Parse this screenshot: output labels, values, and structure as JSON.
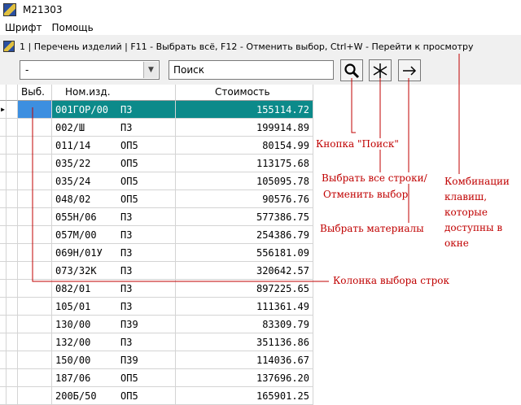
{
  "titlebar": {
    "title": "M21303",
    "icon": "app-icon"
  },
  "menu": {
    "items": [
      "Шрифт",
      "Помощь"
    ]
  },
  "window": {
    "title": "1 | Перечень изделий | F11 - Выбрать всё, F12 - Отменить выбор, Ctrl+W - Перейти к просмотру"
  },
  "toolbar": {
    "combo_value": "-",
    "search_value": "Поиск",
    "buttons": [
      "search-icon",
      "asterisk-icon",
      "arrow-right-icon"
    ]
  },
  "table": {
    "columns": [
      "Выб.",
      "Ном.изд.",
      "Стоимость"
    ],
    "rows": [
      {
        "num": "001ГОР/00",
        "type": "ПЗ",
        "cost": "155114.72"
      },
      {
        "num": "002/Ш",
        "type": "ПЗ",
        "cost": "199914.89"
      },
      {
        "num": "011/14",
        "type": "ОП5",
        "cost": "80154.99"
      },
      {
        "num": "035/22",
        "type": "ОП5",
        "cost": "113175.68"
      },
      {
        "num": "035/24",
        "type": "ОП5",
        "cost": "105095.78"
      },
      {
        "num": "048/02",
        "type": "ОП5",
        "cost": "90576.76"
      },
      {
        "num": "055Н/06",
        "type": "ПЗ",
        "cost": "577386.75"
      },
      {
        "num": "057М/00",
        "type": "ПЗ",
        "cost": "254386.79"
      },
      {
        "num": "069Н/01У",
        "type": "ПЗ",
        "cost": "556181.09"
      },
      {
        "num": "073/32К",
        "type": "ПЗ",
        "cost": "320642.57"
      },
      {
        "num": "082/01",
        "type": "ПЗ",
        "cost": "897225.65"
      },
      {
        "num": "105/01",
        "type": "ПЗ",
        "cost": "111361.49"
      },
      {
        "num": "130/00",
        "type": "ПЗ9",
        "cost": "83309.79"
      },
      {
        "num": "132/00",
        "type": "ПЗ",
        "cost": "351136.86"
      },
      {
        "num": "150/00",
        "type": "ПЗ9",
        "cost": "114036.67"
      },
      {
        "num": "187/06",
        "type": "ОП5",
        "cost": "137696.20"
      },
      {
        "num": "200Б/50",
        "type": "ОП5",
        "cost": "165901.25"
      }
    ]
  },
  "annotations": {
    "search": "Кнопка \"Поиск\"",
    "select_all_1": "Выбрать все строки/",
    "select_all_2": "Отменить выбор",
    "materials": "Выбрать материалы",
    "shortcuts": [
      "Комбинации",
      "клавиш,",
      "которые",
      "доступны в",
      "окне"
    ],
    "column": "Колонка выбора строк"
  },
  "colors": {
    "selected_row": "#0c8a8a",
    "selected_cell": "#3d8fe0",
    "annotation": "#c00000"
  }
}
